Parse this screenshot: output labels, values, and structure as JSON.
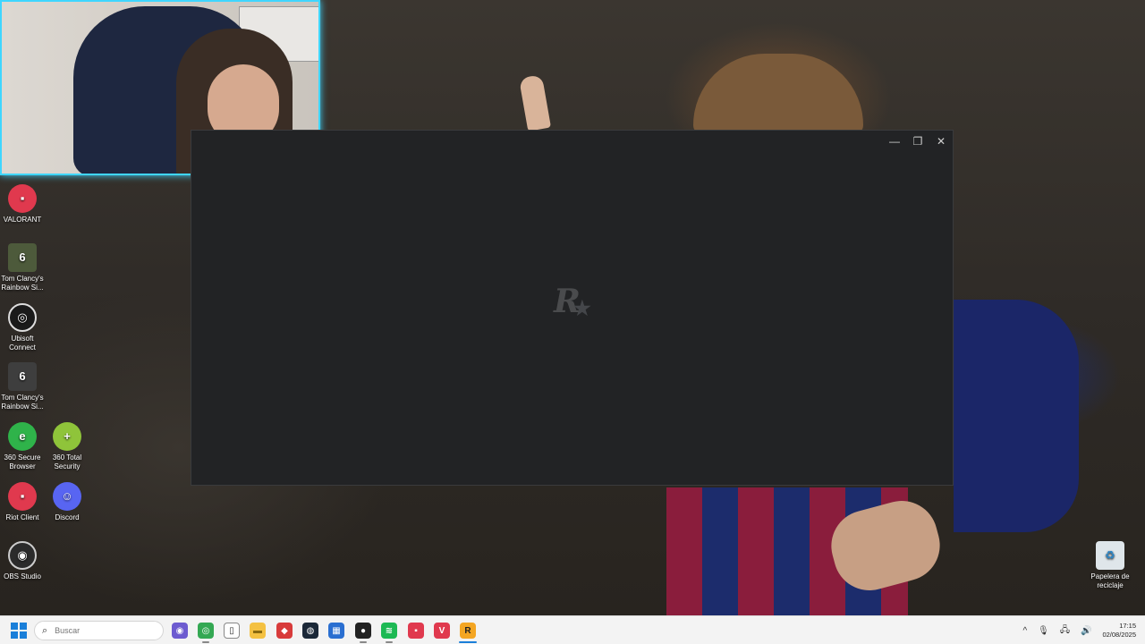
{
  "desktop": {
    "icons": [
      {
        "label": "VALORANT",
        "icon": "valorant-icon",
        "color": "#e0394e"
      },
      {
        "label": "Tom Clancy's Rainbow Si...",
        "icon": "rainbow-six-icon",
        "color": "#4d5a3b"
      },
      {
        "label": "Ubisoft Connect",
        "icon": "ubisoft-icon",
        "color": "#1a1a1a"
      },
      {
        "label": "Tom Clancy's Rainbow Si...",
        "icon": "rainbow-six-icon",
        "color": "#3e3e3e"
      },
      {
        "label": "360 Secure Browser",
        "icon": "360-browser-icon",
        "color": "#2fb34a"
      },
      {
        "label": "360 Total Security",
        "icon": "360-security-icon",
        "color": "#8fc43a"
      },
      {
        "label": "Riot Client",
        "icon": "riot-client-icon",
        "color": "#e0394e"
      },
      {
        "label": "Discord",
        "icon": "discord-icon",
        "color": "#5865f2"
      },
      {
        "label": "OBS Studio",
        "icon": "obs-icon",
        "color": "#2b2b2b"
      }
    ],
    "recycle_bin": {
      "label": "Papelera de reciclaje",
      "icon": "recycle-bin-icon"
    }
  },
  "window": {
    "logo_text": "R",
    "controls": {
      "minimize": "—",
      "maximize": "❐",
      "close": "✕"
    }
  },
  "taskbar": {
    "search": {
      "placeholder": "Buscar"
    },
    "apps": [
      {
        "icon": "copilot-icon",
        "color": "#6d5bd0",
        "glyph": "◉"
      },
      {
        "icon": "chrome-icon",
        "color": "#34a853",
        "glyph": "◎"
      },
      {
        "icon": "notepad-icon",
        "color": "#ffffff",
        "glyph": "▯"
      },
      {
        "icon": "file-explorer-icon",
        "color": "#f4c142",
        "glyph": "▬"
      },
      {
        "icon": "media-icon",
        "color": "#d83b3b",
        "glyph": "◆"
      },
      {
        "icon": "steam-icon",
        "color": "#1b2838",
        "glyph": "◍"
      },
      {
        "icon": "store-icon",
        "color": "#2a6fd1",
        "glyph": "▦"
      },
      {
        "icon": "obs-icon",
        "color": "#222222",
        "glyph": "●"
      },
      {
        "icon": "spotify-icon",
        "color": "#1db954",
        "glyph": "≋"
      },
      {
        "icon": "riot-client-icon",
        "color": "#e0394e",
        "glyph": "▪"
      },
      {
        "icon": "valorant-icon",
        "color": "#e0394e",
        "glyph": "V"
      },
      {
        "icon": "rockstar-icon",
        "color": "#f4a623",
        "glyph": "R"
      }
    ],
    "tray": {
      "chevron": "^",
      "time": "17:15",
      "date": "02/08/2025"
    }
  }
}
